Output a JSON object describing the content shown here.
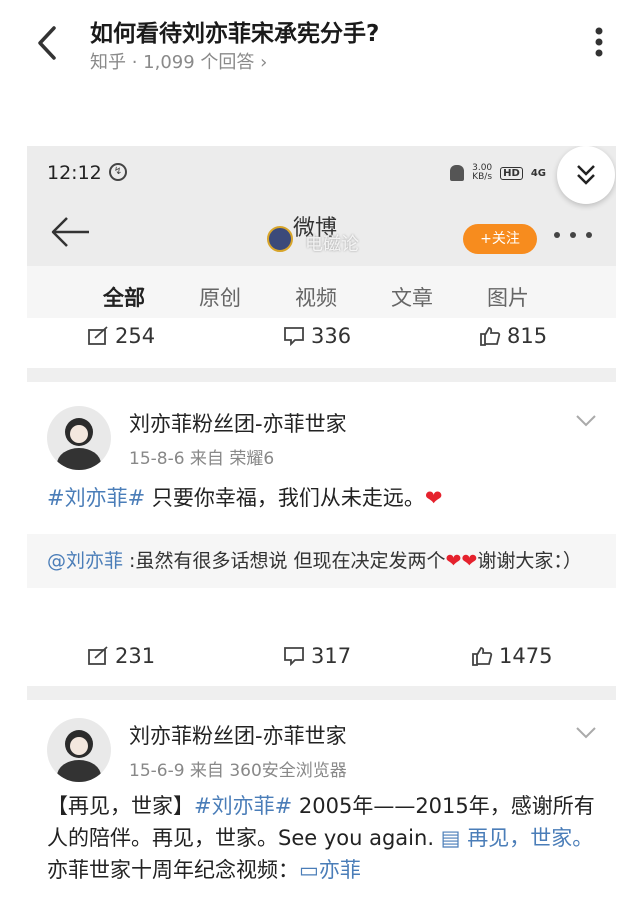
{
  "zhihu": {
    "title": "如何看待刘亦菲宋承宪分手?",
    "subtitle": "知乎 · 1,099 个回答 ›"
  },
  "status": {
    "time": "12:12",
    "speed_top": "3.00",
    "speed_bottom": "KB/s",
    "hd": "HD",
    "signal": "4G"
  },
  "nav": {
    "logo_text": "微博",
    "watermark": "电磁论",
    "follow_label": "+关注"
  },
  "tabs": [
    "全部",
    "原创",
    "视频",
    "文章",
    "图片"
  ],
  "top_counts": {
    "repost": "254",
    "comment": "336",
    "like": "815"
  },
  "posts": [
    {
      "author": "刘亦菲粉丝团-亦菲世家",
      "meta": "15-8-6   来自 荣耀6",
      "tag": "#刘亦菲#",
      "text": " 只要你幸福，我们从未走远。",
      "heart": "❤",
      "repost_at": "@刘亦菲",
      "repost_text": " :虽然有很多话想说 但现在决定发两个",
      "repost_hearts": "❤❤",
      "repost_tail": "谢谢大家：）",
      "counts": {
        "repost": "231",
        "comment": "317",
        "like": "1475"
      }
    },
    {
      "author": "刘亦菲粉丝团-亦菲世家",
      "meta": "15-6-9   来自 360安全浏览器",
      "prefix": "【再见，世家】",
      "tag": "#刘亦菲#",
      "text": " 2005年——2015年，感谢所有人的陪伴。再见，世家。See you again. ",
      "link1": "▤ 再见，世家。",
      "text2": " 亦菲世家十周年纪念视频：",
      "link2": "▭亦菲"
    }
  ]
}
